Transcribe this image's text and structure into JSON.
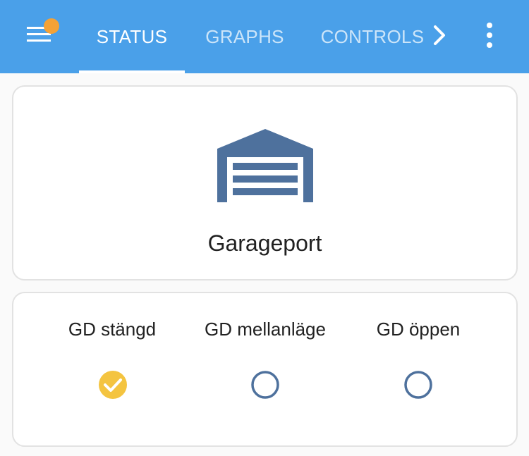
{
  "appbar": {
    "color": "#4aa0e9",
    "menu_icon": "hamburger-menu-icon",
    "notification_color": "#f4a236",
    "tabs": [
      {
        "label": "STATUS",
        "active": true
      },
      {
        "label": "GRAPHS",
        "active": false
      },
      {
        "label": "CONTROLS",
        "active": false
      }
    ],
    "scroll_icon": "chevron-right-icon",
    "overflow_icon": "more-vert-icon"
  },
  "garage_card": {
    "icon": "garage-door-icon",
    "icon_color": "#4e719d",
    "title": "Garageport"
  },
  "states_card": {
    "items": [
      {
        "label": "GD stängd",
        "checked": true,
        "icon": "check-circle-icon",
        "color": "#f4c440"
      },
      {
        "label": "GD mellanläge",
        "checked": false,
        "icon": "circle-outline-icon",
        "color": "#4e719d"
      },
      {
        "label": "GD öppen",
        "checked": false,
        "icon": "circle-outline-icon",
        "color": "#4e719d"
      }
    ]
  }
}
